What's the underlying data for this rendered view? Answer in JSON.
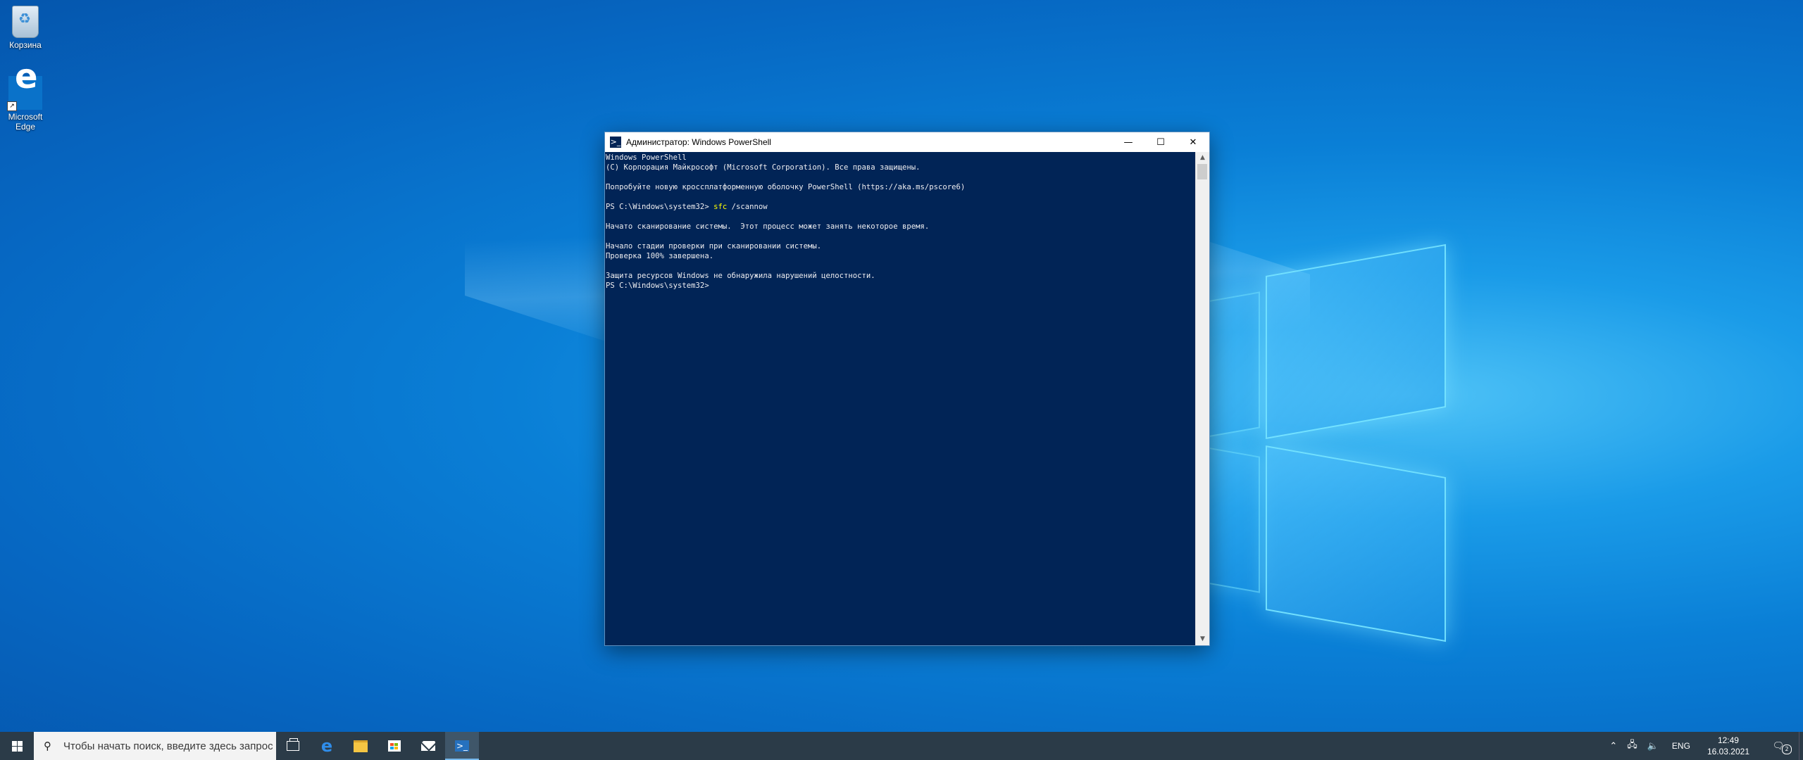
{
  "desktop": {
    "icons": [
      {
        "label": "Корзина"
      },
      {
        "label": "Microsoft Edge"
      }
    ]
  },
  "window": {
    "title": "Администратор: Windows PowerShell",
    "console": {
      "lines_before_cmd": "Windows PowerShell\n(C) Корпорация Майкрософт (Microsoft Corporation). Все права защищены.\n\nПопробуйте новую кроссплатформенную оболочку PowerShell (https://aka.ms/pscore6)\n\n",
      "prompt1": "PS C:\\Windows\\system32> ",
      "command": "sfc",
      "command_args": " /scannow",
      "output": "\n\nНачато сканирование системы.  Этот процесс может занять некоторое время.\n\nНачало стадии проверки при сканировании системы.\nПроверка 100% завершена.\n\nЗащита ресурсов Windows не обнаружила нарушений целостности.\n",
      "prompt2": "PS C:\\Windows\\system32>"
    },
    "colors": {
      "console_bg": "#012456",
      "console_fg": "#eeedf0",
      "command": "#ffff00"
    }
  },
  "taskbar": {
    "search_placeholder": "Чтобы начать поиск, введите здесь запрос",
    "tray": {
      "language": "ENG",
      "time": "12:49",
      "date": "16.03.2021",
      "notification_count": "2"
    }
  }
}
